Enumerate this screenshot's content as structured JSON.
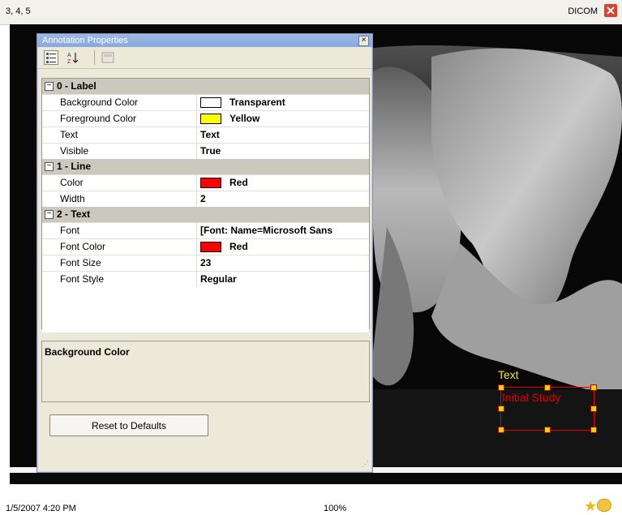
{
  "topbar": {
    "title": "3, 4, 5",
    "mode": "DICOM"
  },
  "dialog": {
    "title": "Annotation Properties",
    "close_glyph": "×",
    "categories": [
      {
        "title": "0 - Label",
        "toggle": "−"
      },
      {
        "title": "1 - Line",
        "toggle": "−"
      },
      {
        "title": "2 - Text",
        "toggle": "−"
      }
    ],
    "label_props": [
      {
        "name": "Background Color",
        "value": "Transparent",
        "swatch": "#ffffff"
      },
      {
        "name": "Foreground Color",
        "value": "Yellow",
        "swatch": "#ffff00"
      },
      {
        "name": "Text",
        "value": "Text"
      },
      {
        "name": "Visible",
        "value": "True"
      }
    ],
    "line_props": [
      {
        "name": "Color",
        "value": "Red",
        "swatch": "#ff0000"
      },
      {
        "name": "Width",
        "value": "2"
      }
    ],
    "text_props": [
      {
        "name": "Font",
        "value": "[Font: Name=Microsoft Sans"
      },
      {
        "name": "Font Color",
        "value": "Red",
        "swatch": "#ff0000"
      },
      {
        "name": "Font Size",
        "value": "23"
      },
      {
        "name": "Font Style",
        "value": "Regular"
      }
    ],
    "description_title": "Background Color",
    "reset_label": "Reset to Defaults",
    "toolbar_icons": [
      "categorized-icon",
      "alphabetical-icon",
      "property-pages-icon"
    ]
  },
  "overlay": {
    "text_label": "Text",
    "box_label": "Initial Study",
    "text_color": "#f2ea00",
    "box_color": "#e00000"
  },
  "statusbar": {
    "datetime": "1/5/2007 4:20 PM",
    "zoom": "100%"
  }
}
